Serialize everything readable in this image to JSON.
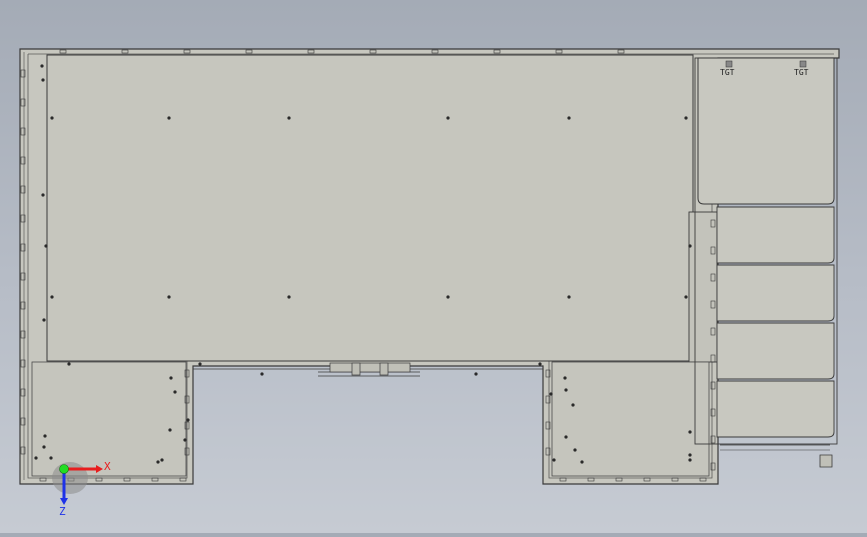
{
  "viewport": {
    "background": "#b3b9c3",
    "part_fill": "#c8c8c0",
    "inner_fill": "#c4c4bc",
    "edge_color": "#3a3a3a"
  },
  "triad": {
    "x_label": "X",
    "z_label": "Z",
    "x_color": "#e81e1e",
    "z_color": "#1e32e8",
    "origin_color": "#22dd22"
  },
  "clamps": {
    "top_left_label": "TGT",
    "top_right_label": "TGT"
  }
}
